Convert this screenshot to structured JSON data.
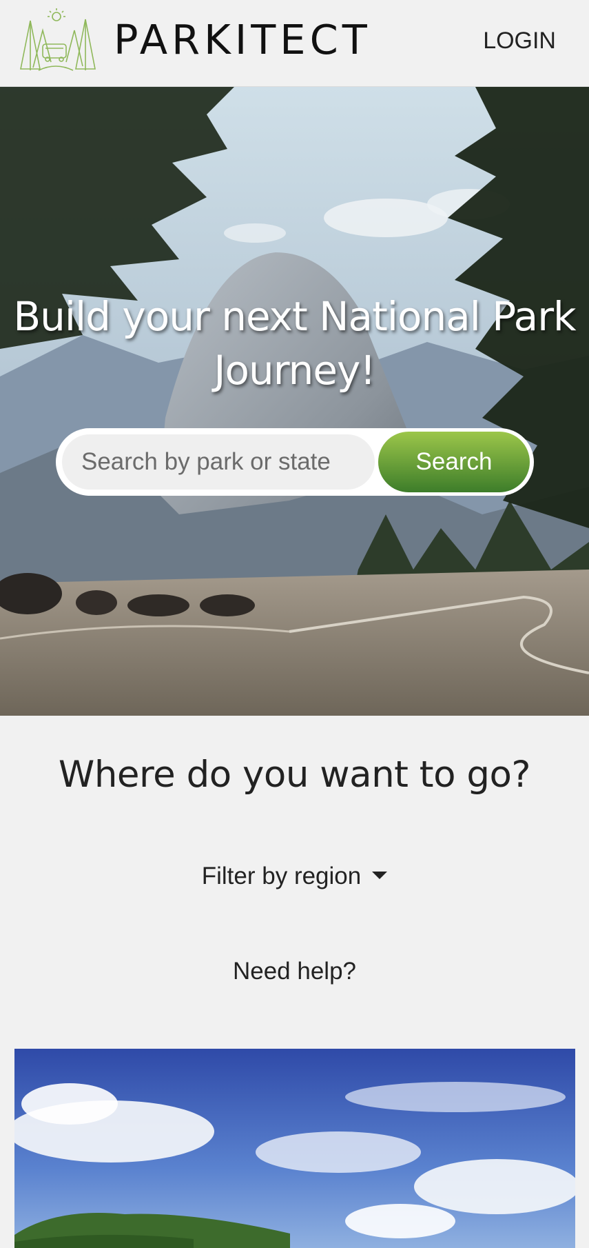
{
  "header": {
    "brand": "PARKITECT",
    "login_label": "LOGIN"
  },
  "hero": {
    "title_line1": "Build your next National Park",
    "title_line2": "Journey!",
    "search_placeholder": "Search by park or state",
    "search_button_label": "Search"
  },
  "main": {
    "section_title": "Where do you want to go?",
    "filter_label": "Filter by region",
    "help_label": "Need help?"
  },
  "colors": {
    "background": "#f1f1f1",
    "search_button_top": "#9cc64a",
    "search_button_bottom": "#3d7d2a",
    "text": "#222222"
  }
}
